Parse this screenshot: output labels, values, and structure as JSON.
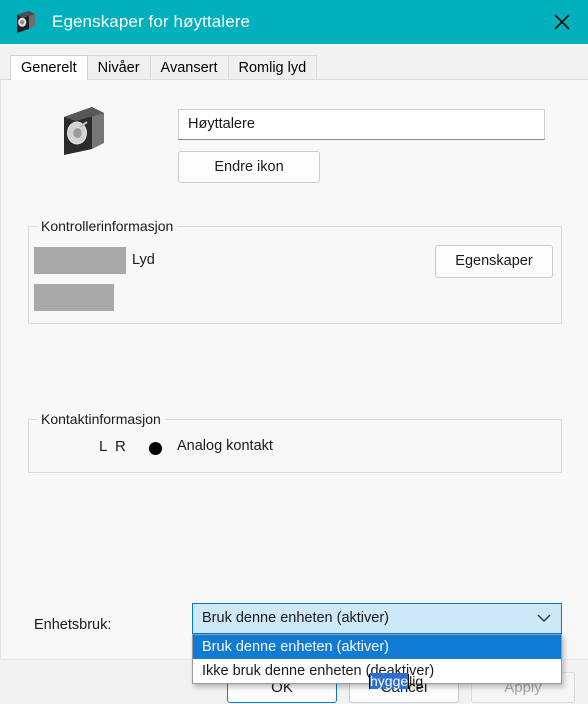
{
  "window": {
    "title": "Egenskaper for høyttalere",
    "icon": "speaker-icon",
    "close_icon": "close-icon",
    "titlebar_color": "#00b0bd"
  },
  "tabs": [
    {
      "label": "Generelt",
      "active": true
    },
    {
      "label": "Nivåer",
      "active": false
    },
    {
      "label": "Avansert",
      "active": false
    },
    {
      "label": "Romlig lyd",
      "active": false
    }
  ],
  "general": {
    "device_icon": "speaker-icon",
    "name_value": "Høyttalere",
    "name_placeholder": "",
    "change_icon_label": "Endre ikon"
  },
  "controller_group": {
    "title": "Kontrollerinformasjon",
    "redacted_line1": "",
    "redacted_line2": "",
    "suffix_label": "Lyd",
    "properties_label": "Egenskaper"
  },
  "jack_group": {
    "title": "Kontaktinformasjon",
    "channels": "L R",
    "jack_icon": "jack-dot-icon",
    "jack_label": "Analog kontakt"
  },
  "device_usage": {
    "label": "Enhetsbruk:",
    "selected": "Bruk denne enheten (aktiver)",
    "chevron_icon": "chevron-down-icon",
    "options": [
      {
        "label": "Bruk denne enheten (aktiver)",
        "selected": true
      },
      {
        "label": "Ikke bruk denne enheten (deaktiver)",
        "selected": false
      }
    ]
  },
  "buttons": {
    "ok": "OK",
    "cancel": "Cancel",
    "apply": "Apply",
    "apply_disabled": true
  },
  "ime_overlay": {
    "prefix": "",
    "composition": "hygge",
    "suffix": "lig"
  },
  "colors": {
    "accent": "#0078d4",
    "titlebar": "#00b0bd",
    "highlight": "#0f7bd4",
    "combo_fill": "#cfe8f7"
  }
}
